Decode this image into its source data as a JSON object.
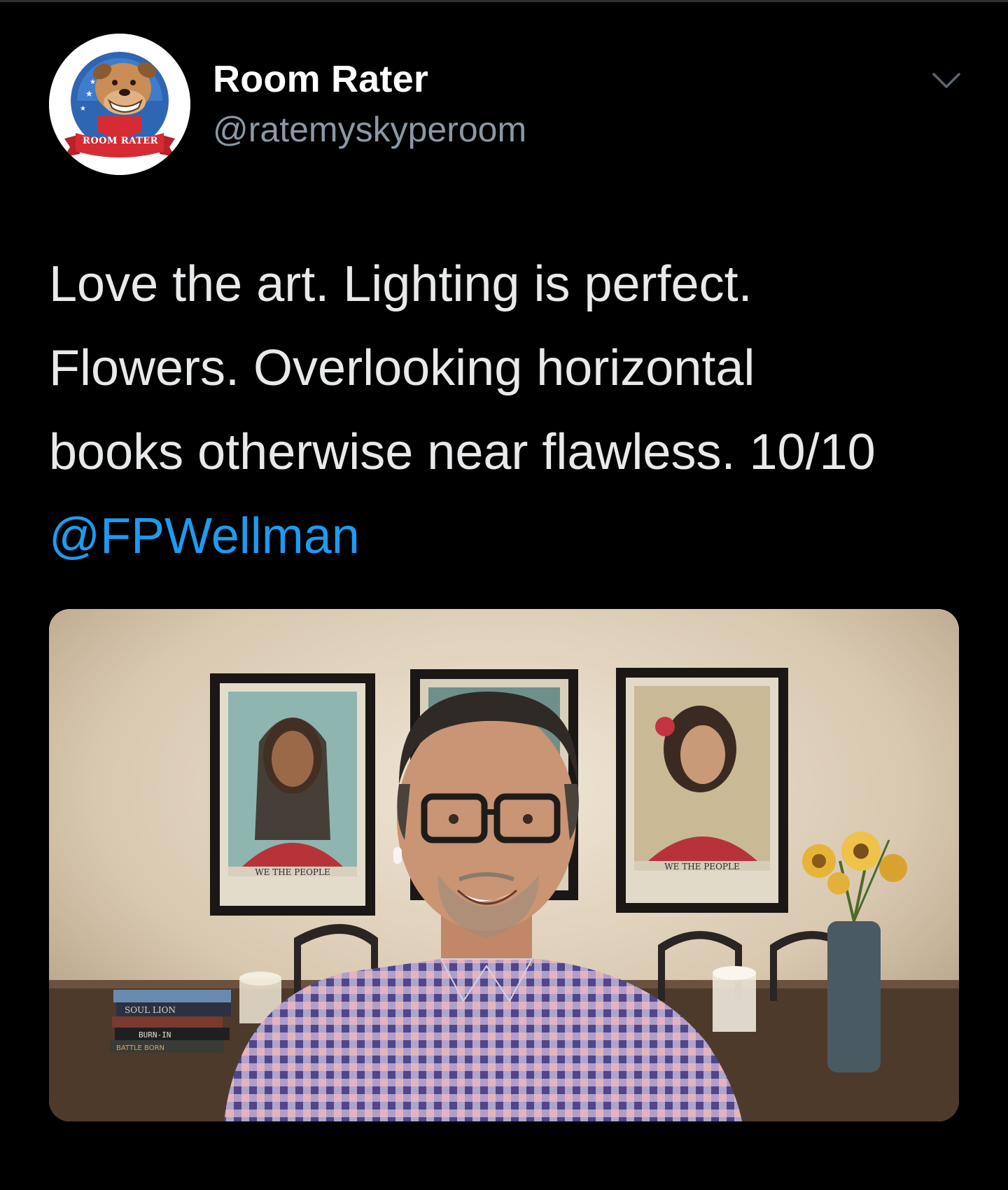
{
  "tweet": {
    "author": {
      "display_name": "Room Rater",
      "handle": "@ratemyskyperoom",
      "avatar_banner_text": "ROOM RATER"
    },
    "menu_icon": "chevron-down-icon",
    "text_lines": [
      "Love the art. Lighting is perfect.",
      "Flowers. Overlooking horizontal",
      "books otherwise near flawless. 10/10"
    ],
    "mention": "@FPWellman"
  },
  "media": {
    "poster_caption_left": "WE THE PEOPLE",
    "poster_caption_right": "WE THE PEOPLE",
    "book_spines": [
      "SOUL LION",
      "BURN-IN",
      "BATTLE BORN"
    ]
  },
  "colors": {
    "background": "#000000",
    "text": "#e7e9ea",
    "secondary_text": "#8b98a5",
    "link": "#1d9bf0"
  }
}
